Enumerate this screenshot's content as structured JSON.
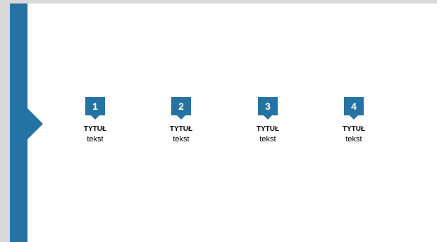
{
  "colors": {
    "accent": "#2473a2",
    "frame": "#d9d9d9",
    "slide_background": "#ffffff",
    "text": "#000000"
  },
  "steps": [
    {
      "number": "1",
      "title": "TYTUŁ",
      "text": "tekst"
    },
    {
      "number": "2",
      "title": "TYTUŁ",
      "text": "tekst"
    },
    {
      "number": "3",
      "title": "TYTUŁ",
      "text": "tekst"
    },
    {
      "number": "4",
      "title": "TYTUŁ",
      "text": "tekst"
    }
  ]
}
